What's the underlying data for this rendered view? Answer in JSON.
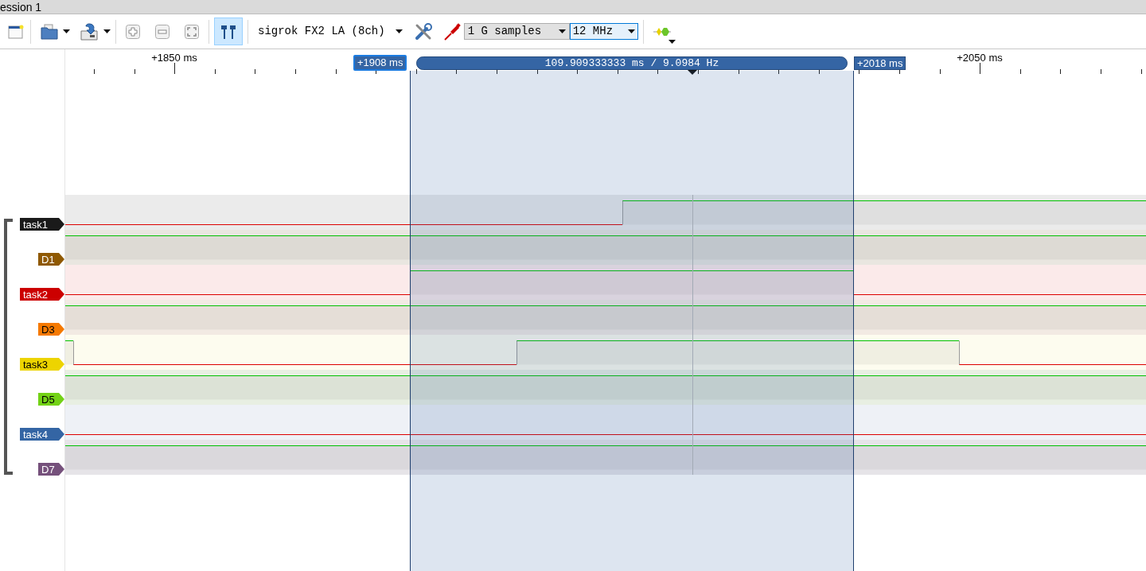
{
  "window": {
    "title": "ession 1"
  },
  "toolbar": {
    "cursors_toggle": {
      "selected": true
    },
    "device": "sigrok FX2 LA (8ch)",
    "sample_count": "1 G samples",
    "sample_rate": "12 MHz"
  },
  "ruler": {
    "labels": [
      "+1850 ms",
      "+2050 ms"
    ]
  },
  "cursors": {
    "start": "+1908 ms",
    "span": "109.909333333 ms / 9.0984 Hz",
    "end": "+2018 ms"
  },
  "channels": [
    {
      "name": "task1",
      "color": "#1a1a1a"
    },
    {
      "name": "D1",
      "color": "#8f5902"
    },
    {
      "name": "task2",
      "color": "#cc0000"
    },
    {
      "name": "D3",
      "color": "#f57900"
    },
    {
      "name": "task3",
      "color": "#edd400"
    },
    {
      "name": "D5",
      "color": "#73d216"
    },
    {
      "name": "task4",
      "color": "#3465a4"
    },
    {
      "name": "D7",
      "color": "#75507b"
    }
  ]
}
